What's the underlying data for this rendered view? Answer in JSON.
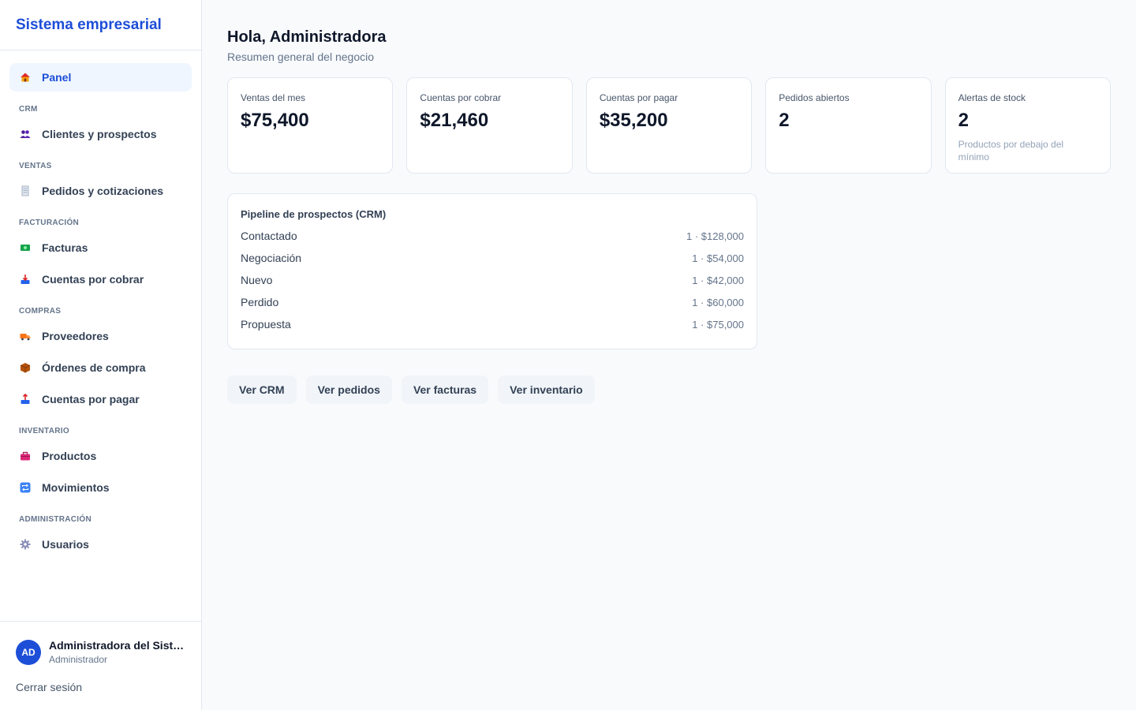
{
  "app": {
    "title": "Sistema empresarial"
  },
  "sidebar": {
    "panel": {
      "label": "Panel",
      "icon": "house-icon"
    },
    "sections": [
      {
        "title": "CRM",
        "items": [
          {
            "label": "Clientes y prospectos",
            "icon": "people-icon"
          }
        ]
      },
      {
        "title": "VENTAS",
        "items": [
          {
            "label": "Pedidos y cotizaciones",
            "icon": "receipt-icon"
          }
        ]
      },
      {
        "title": "FACTURACIÓN",
        "items": [
          {
            "label": "Facturas",
            "icon": "money-icon"
          },
          {
            "label": "Cuentas por cobrar",
            "icon": "inbox-tray-icon"
          }
        ]
      },
      {
        "title": "COMPRAS",
        "items": [
          {
            "label": "Proveedores",
            "icon": "truck-icon"
          },
          {
            "label": "Órdenes de compra",
            "icon": "package-icon"
          },
          {
            "label": "Cuentas por pagar",
            "icon": "outbox-tray-icon"
          }
        ]
      },
      {
        "title": "INVENTARIO",
        "items": [
          {
            "label": "Productos",
            "icon": "toolbox-icon"
          },
          {
            "label": "Movimientos",
            "icon": "repeat-icon"
          }
        ]
      },
      {
        "title": "ADMINISTRACIÓN",
        "items": [
          {
            "label": "Usuarios",
            "icon": "gear-icon"
          }
        ]
      }
    ]
  },
  "user": {
    "initials": "AD",
    "name": "Administradora del Sistema",
    "role": "Administrador",
    "logout": "Cerrar sesión"
  },
  "main": {
    "greeting": "Hola, Administradora",
    "subtitle": "Resumen general del negocio",
    "stats": [
      {
        "label": "Ventas del mes",
        "value": "$75,400"
      },
      {
        "label": "Cuentas por cobrar",
        "value": "$21,460"
      },
      {
        "label": "Cuentas por pagar",
        "value": "$35,200"
      },
      {
        "label": "Pedidos abiertos",
        "value": "2"
      },
      {
        "label": "Alertas de stock",
        "value": "2",
        "note": "Productos por debajo del mínimo"
      }
    ],
    "pipeline": {
      "title": "Pipeline de prospectos (CRM)",
      "rows": [
        {
          "stage": "Contactado",
          "value": "1 · $128,000"
        },
        {
          "stage": "Negociación",
          "value": "1 · $54,000"
        },
        {
          "stage": "Nuevo",
          "value": "1 · $42,000"
        },
        {
          "stage": "Perdido",
          "value": "1 · $60,000"
        },
        {
          "stage": "Propuesta",
          "value": "1 · $75,000"
        }
      ]
    },
    "actions": [
      "Ver CRM",
      "Ver pedidos",
      "Ver facturas",
      "Ver inventario"
    ]
  },
  "colors": {
    "accent": "#1d4ed8",
    "active_bg": "#eff6ff",
    "page_bg": "#f8fafc"
  }
}
